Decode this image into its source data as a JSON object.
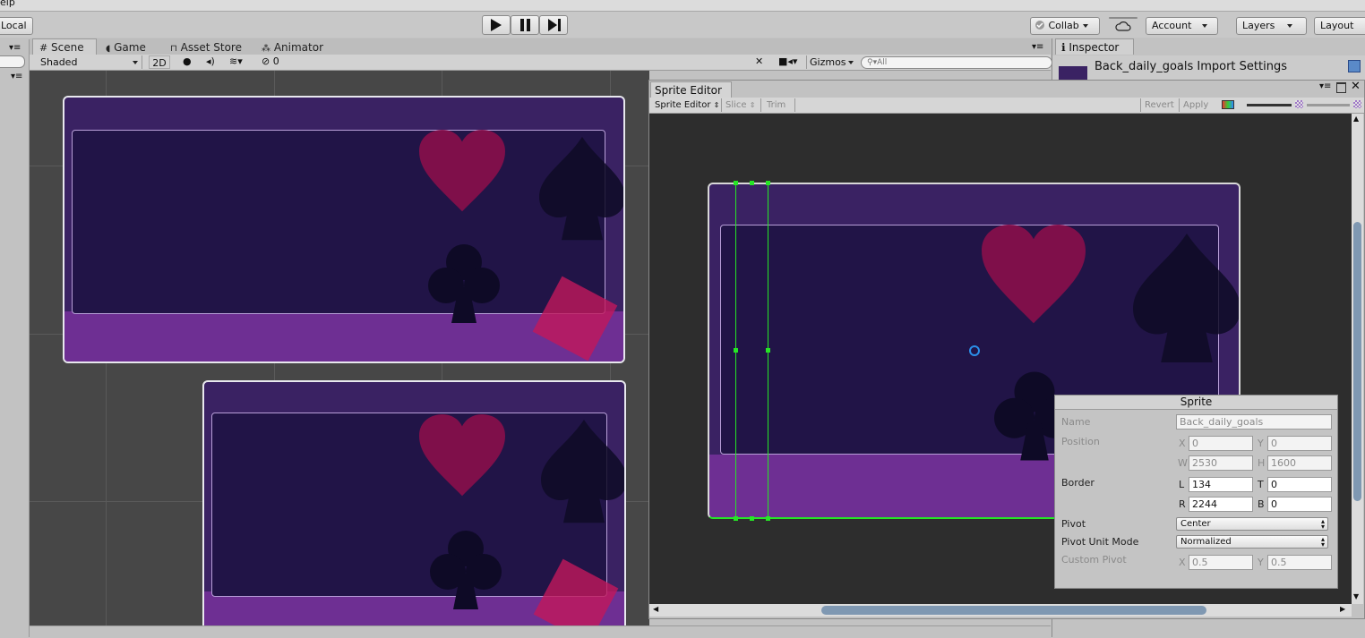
{
  "menubar": {
    "help_partial": "elp"
  },
  "toolbar": {
    "pivot_mode": "Local",
    "play_icon": "play-icon",
    "pause_icon": "pause-icon",
    "step_icon": "step-icon",
    "collab": "Collab",
    "account": "Account",
    "layers": "Layers",
    "layout": "Layout"
  },
  "scene_tabs": [
    {
      "label": "Scene",
      "icon": "grid-icon"
    },
    {
      "label": "Game",
      "icon": "pacman-icon"
    },
    {
      "label": "Asset Store",
      "icon": "bag-icon"
    },
    {
      "label": "Animator",
      "icon": "nodes-icon"
    }
  ],
  "scene_toolbar": {
    "draw_mode": "Shaded",
    "mode_2d": "2D",
    "hidden_count": "0",
    "gizmos": "Gizmos",
    "search_placeholder": "All"
  },
  "inspector": {
    "tab": "Inspector",
    "title": "Back_daily_goals Import Settings"
  },
  "sprite_editor": {
    "window_title": "Sprite Editor",
    "mode_dropdown": "Sprite Editor",
    "slice": "Slice",
    "trim": "Trim",
    "revert": "Revert",
    "apply": "Apply"
  },
  "sprite_panel": {
    "header": "Sprite",
    "name_label": "Name",
    "name_value": "Back_daily_goals",
    "position_label": "Position",
    "x_label": "X",
    "x_value": "0",
    "y_label": "Y",
    "y_value": "0",
    "w_label": "W",
    "w_value": "2530",
    "h_label": "H",
    "h_value": "1600",
    "border_label": "Border",
    "l_label": "L",
    "l_value": "134",
    "t_label": "T",
    "t_value": "0",
    "r_label": "R",
    "r_value": "2244",
    "b_label": "B",
    "b_value": "0",
    "pivot_label": "Pivot",
    "pivot_value": "Center",
    "pivot_unit_label": "Pivot Unit Mode",
    "pivot_unit_value": "Normalized",
    "custom_pivot_label": "Custom Pivot",
    "cp_x_label": "X",
    "cp_x_value": "0.5",
    "cp_y_label": "Y",
    "cp_y_value": "0.5"
  },
  "colors": {
    "card_purple": "#3a2263",
    "card_inner": "#211447",
    "card_bottom": "#6e2f93",
    "scene_bg": "#474747",
    "sprite_bg": "#2d2d2d",
    "handle_green": "#26e626"
  }
}
